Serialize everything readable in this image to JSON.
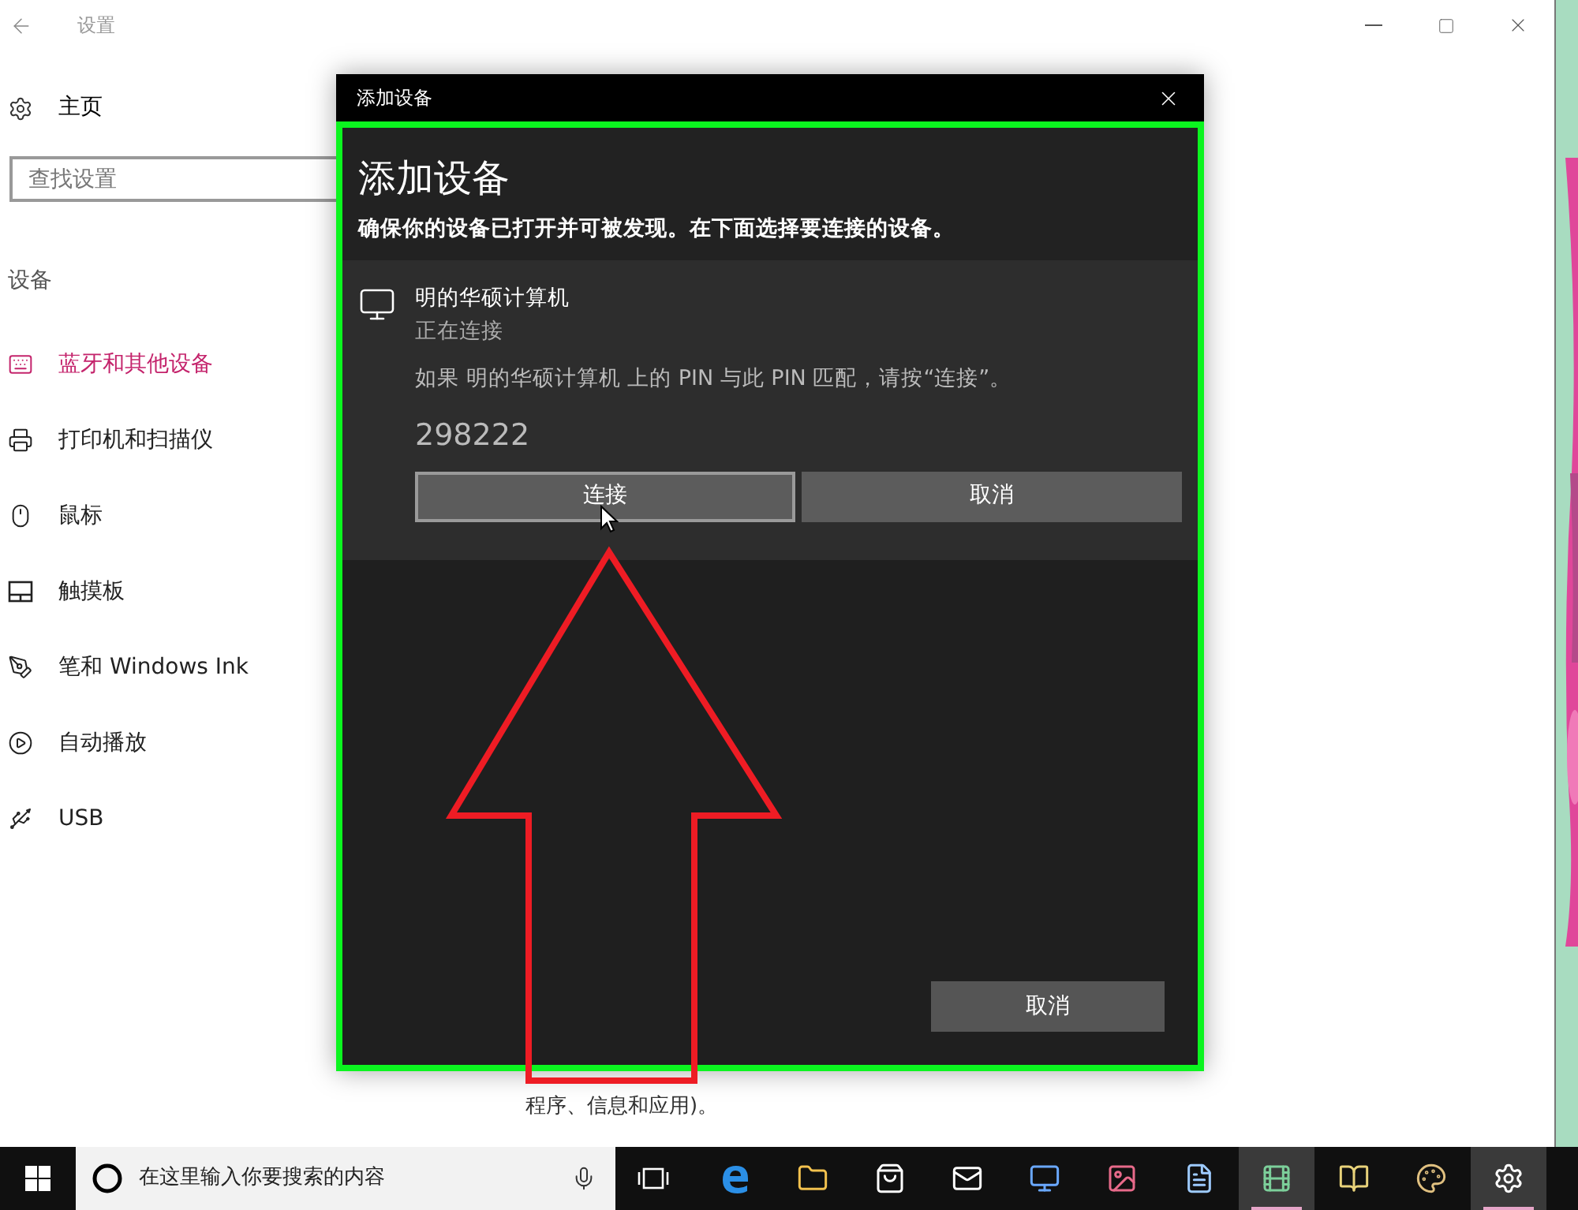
{
  "window": {
    "title": "设置"
  },
  "sidebar": {
    "home": "主页",
    "search": {
      "placeholder": "查找设置"
    },
    "section": "设备",
    "items": [
      {
        "label": "蓝牙和其他设备",
        "kind": "bluetooth",
        "selected": true
      },
      {
        "label": "打印机和扫描仪",
        "kind": "printer",
        "selected": false
      },
      {
        "label": "鼠标",
        "kind": "mouse",
        "selected": false
      },
      {
        "label": "触摸板",
        "kind": "touchpad",
        "selected": false
      },
      {
        "label": "笔和 Windows Ink",
        "kind": "pen",
        "selected": false
      },
      {
        "label": "自动播放",
        "kind": "autoplay",
        "selected": false
      },
      {
        "label": "USB",
        "kind": "usb",
        "selected": false
      }
    ]
  },
  "background_text": "程序、信息和应用)。",
  "dialog": {
    "title": "添加设备",
    "heading": "添加设备",
    "description": "确保你的设备已打开并可被发现。在下面选择要连接的设备。",
    "device": {
      "name": "明的华硕计算机",
      "status": "正在连接",
      "message": "如果 明的华硕计算机 上的 PIN 与此 PIN 匹配，请按“连接”。",
      "pin": "298222",
      "buttons": [
        {
          "label": "连接",
          "focused": true
        },
        {
          "label": "取消",
          "focused": false
        }
      ]
    },
    "footer_button": "取消"
  },
  "taskbar": {
    "search": {
      "placeholder": "在这里输入你要搜索的内容"
    },
    "apps": [
      {
        "kind": "edge",
        "active": false
      },
      {
        "kind": "files",
        "active": false
      },
      {
        "kind": "store",
        "active": false
      },
      {
        "kind": "mail",
        "active": false
      },
      {
        "kind": "computer",
        "active": false
      },
      {
        "kind": "paint",
        "active": false
      },
      {
        "kind": "document",
        "active": false
      },
      {
        "kind": "media",
        "active": true
      },
      {
        "kind": "books",
        "active": false
      },
      {
        "kind": "palette",
        "active": false
      },
      {
        "kind": "settings",
        "active": true
      }
    ]
  }
}
